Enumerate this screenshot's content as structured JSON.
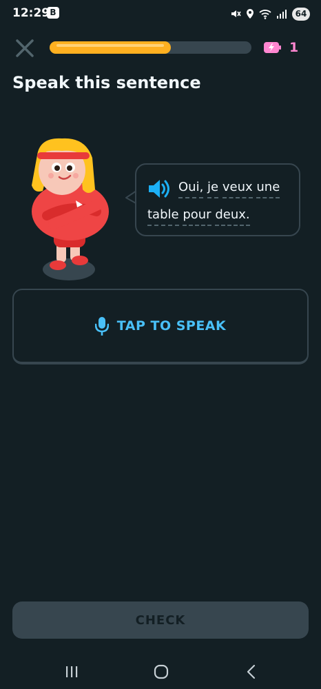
{
  "status_bar": {
    "time": "12:29",
    "app_badge": "B",
    "battery_level": "64"
  },
  "lesson": {
    "progress": 0.6,
    "energy_count": "1",
    "title": "Speak this sentence"
  },
  "prompt": {
    "line1_words": [
      "Oui,",
      "je",
      "veux",
      "une"
    ],
    "line2_words": [
      "table",
      "pour",
      "deux."
    ]
  },
  "buttons": {
    "tap_to_speak": "TAP TO SPEAK",
    "check": "CHECK"
  },
  "colors": {
    "background": "#131f24",
    "progress": "#ffb020",
    "accent_blue": "#49c0f8",
    "energy_pink": "#ff86d0",
    "disabled": "#37464f"
  },
  "icons": {
    "close": "close-icon",
    "energy": "energy-battery-icon",
    "speaker": "speaker-icon",
    "microphone": "microphone-icon"
  }
}
